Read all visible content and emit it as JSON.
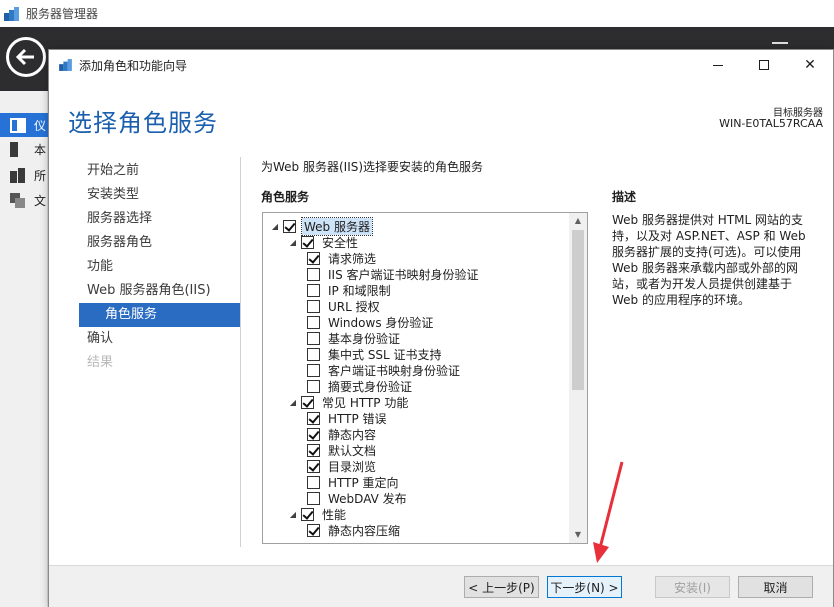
{
  "background_app": {
    "title": "服务器管理器",
    "sidebar": [
      {
        "label": "仪",
        "icon": "dashboard-icon",
        "active": true
      },
      {
        "label": "本",
        "icon": "server-icon",
        "active": false
      },
      {
        "label": "所",
        "icon": "all-servers-icon",
        "active": false
      },
      {
        "label": "文",
        "icon": "file-services-icon",
        "active": false
      }
    ]
  },
  "wizard": {
    "title": "添加角色和功能向导",
    "heading": "选择角色服务",
    "destination_label": "目标服务器",
    "destination_server": "WIN-E0TAL57RCAA",
    "nav": [
      {
        "label": "开始之前",
        "state": "normal"
      },
      {
        "label": "安装类型",
        "state": "normal"
      },
      {
        "label": "服务器选择",
        "state": "normal"
      },
      {
        "label": "服务器角色",
        "state": "normal"
      },
      {
        "label": "功能",
        "state": "normal"
      },
      {
        "label": "Web 服务器角色(IIS)",
        "state": "normal"
      },
      {
        "label": "角色服务",
        "state": "active"
      },
      {
        "label": "确认",
        "state": "normal"
      },
      {
        "label": "结果",
        "state": "disabled"
      }
    ],
    "content_description": "为Web 服务器(IIS)选择要安装的角色服务",
    "role_services_label": "角色服务",
    "description_label": "描述",
    "description_text": "Web 服务器提供对 HTML 网站的支持，以及对 ASP.NET、ASP 和 Web 服务器扩展的支持(可选)。可以使用 Web 服务器来承载内部或外部的网站，或者为开发人员提供创建基于 Web 的应用程序的环境。",
    "tree": [
      {
        "label": "Web 服务器",
        "level": 0,
        "expanded": true,
        "checked": true,
        "selected": true
      },
      {
        "label": "安全性",
        "level": 1,
        "expanded": true,
        "checked": true
      },
      {
        "label": "请求筛选",
        "level": 2,
        "checked": true
      },
      {
        "label": "IIS 客户端证书映射身份验证",
        "level": 2,
        "checked": false
      },
      {
        "label": "IP 和域限制",
        "level": 2,
        "checked": false
      },
      {
        "label": "URL 授权",
        "level": 2,
        "checked": false
      },
      {
        "label": "Windows 身份验证",
        "level": 2,
        "checked": false
      },
      {
        "label": "基本身份验证",
        "level": 2,
        "checked": false
      },
      {
        "label": "集中式 SSL 证书支持",
        "level": 2,
        "checked": false
      },
      {
        "label": "客户端证书映射身份验证",
        "level": 2,
        "checked": false
      },
      {
        "label": "摘要式身份验证",
        "level": 2,
        "checked": false
      },
      {
        "label": "常见 HTTP 功能",
        "level": 1,
        "expanded": true,
        "checked": true
      },
      {
        "label": "HTTP 错误",
        "level": 2,
        "checked": true
      },
      {
        "label": "静态内容",
        "level": 2,
        "checked": true
      },
      {
        "label": "默认文档",
        "level": 2,
        "checked": true
      },
      {
        "label": "目录浏览",
        "level": 2,
        "checked": true
      },
      {
        "label": "HTTP 重定向",
        "level": 2,
        "checked": false
      },
      {
        "label": "WebDAV 发布",
        "level": 2,
        "checked": false
      },
      {
        "label": "性能",
        "level": 1,
        "expanded": true,
        "checked": true
      },
      {
        "label": "静态内容压缩",
        "level": 2,
        "checked": true
      }
    ],
    "scroll_position": 0.0,
    "buttons": {
      "prev": "< 上一步(P)",
      "next": "下一步(N) >",
      "install": "安装(I)",
      "cancel": "取消"
    },
    "window_controls": {
      "minimize": "minimize-icon",
      "maximize": "maximize-icon",
      "close": "close-icon"
    },
    "close_glyph": "✕"
  },
  "annotation": {
    "arrow_color": "#e8303a"
  },
  "colors": {
    "heading": "#1b5fae",
    "nav_active": "#2a6cc2",
    "bg_header": "#2d2d30"
  }
}
